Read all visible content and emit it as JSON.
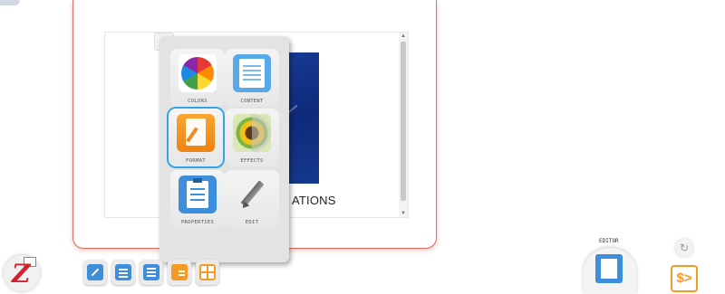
{
  "document": {
    "visible_text": "ATIONS"
  },
  "format_menu": {
    "items": [
      {
        "id": "colors",
        "label": "COLORS",
        "icon": "color-wheel-icon"
      },
      {
        "id": "content",
        "label": "CONTENT",
        "icon": "document-content-icon"
      },
      {
        "id": "format",
        "label": "FORMAT",
        "icon": "format-pen-icon",
        "selected": true
      },
      {
        "id": "effects",
        "label": "EFFECTS",
        "icon": "effects-flower-icon"
      },
      {
        "id": "properties",
        "label": "PROPERTIES",
        "icon": "clipboard-list-icon"
      },
      {
        "id": "edit",
        "label": "EDIT",
        "icon": "pencil-icon"
      }
    ]
  },
  "editor": {
    "label": "EDITOR"
  },
  "price": {
    "symbol": "$>"
  },
  "colors": {
    "accent_blue": "#3d8fdc",
    "accent_orange": "#f59b25",
    "selection_outline": "#2fa4e7",
    "card_border": "#e06a5e",
    "logo_red": "#d3202e"
  }
}
